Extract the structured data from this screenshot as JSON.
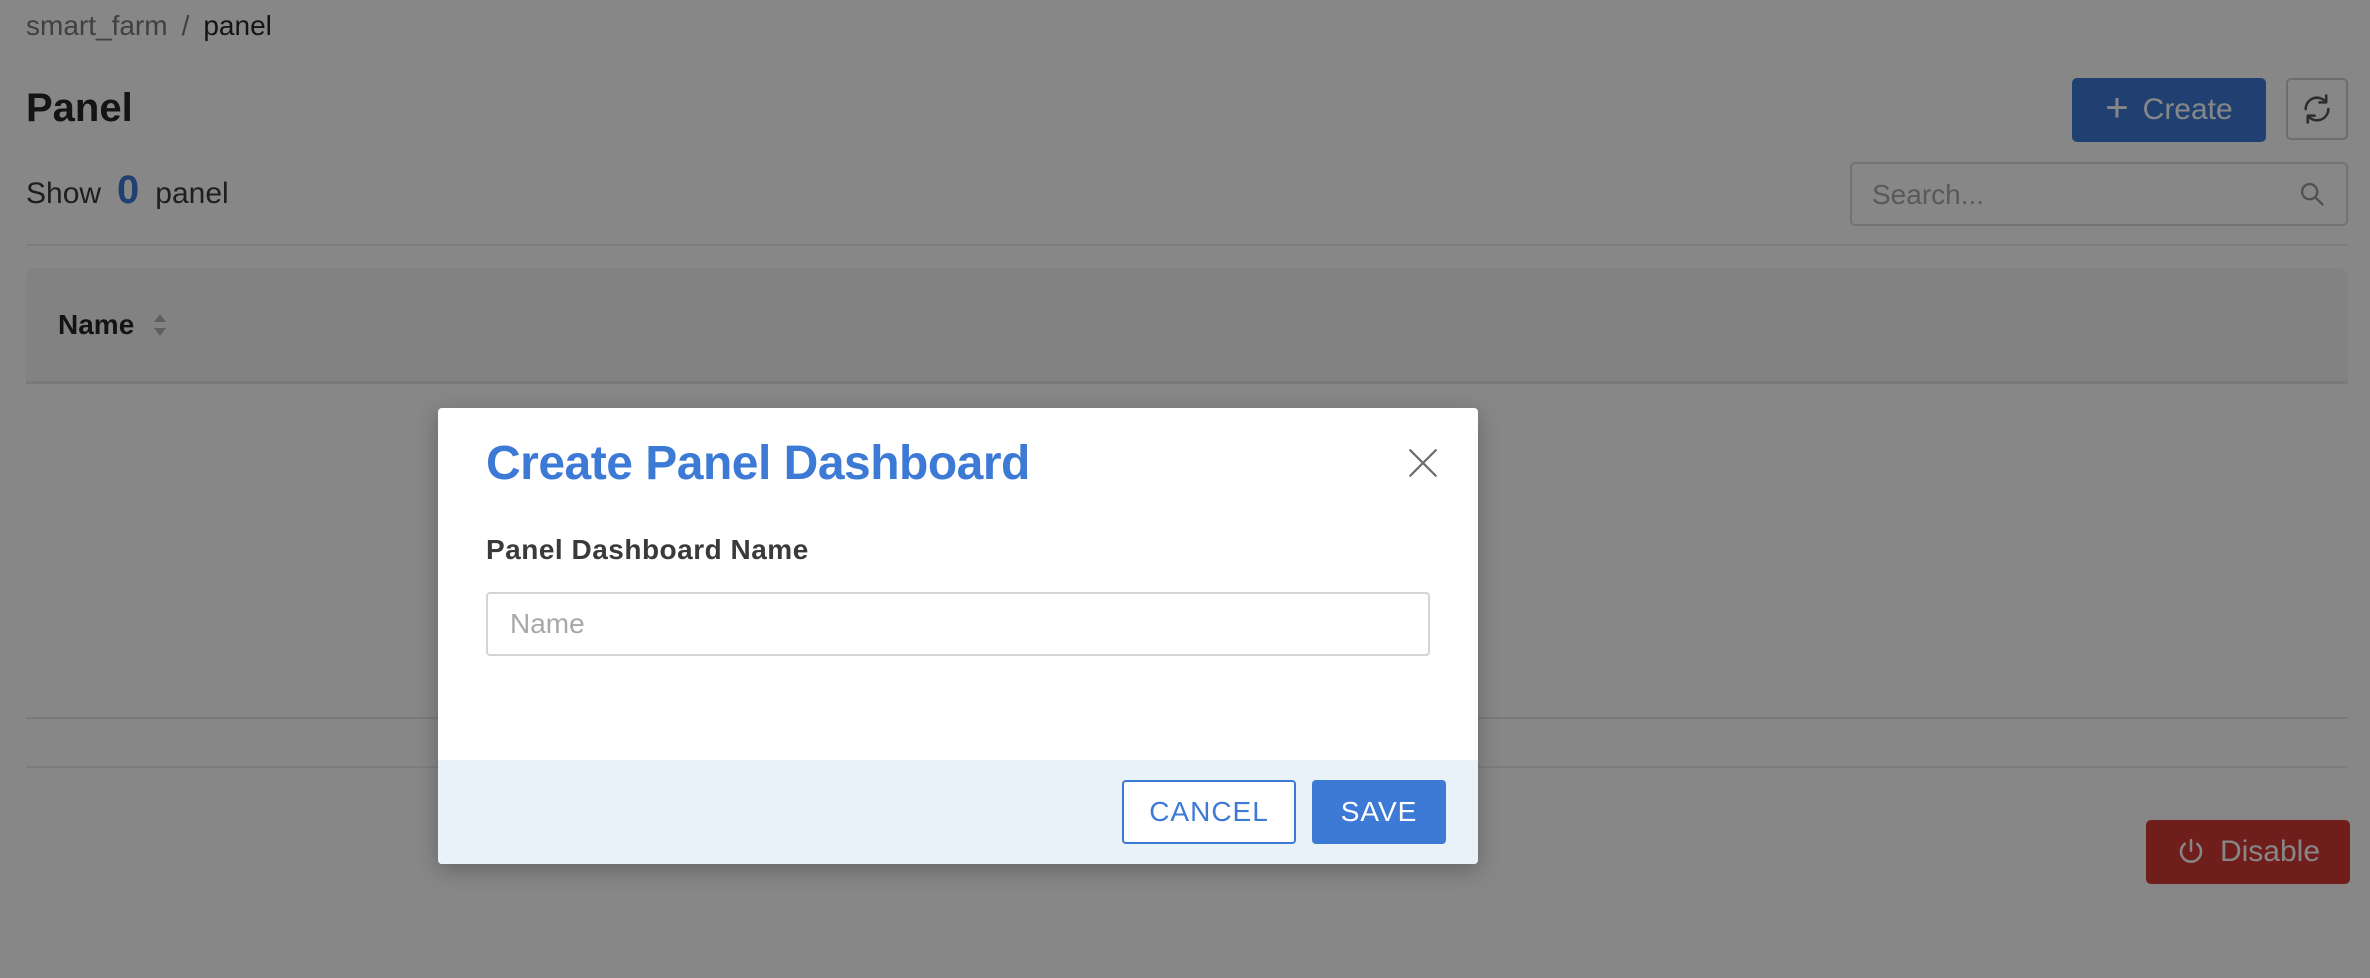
{
  "breadcrumb": {
    "parent": "smart_farm",
    "separator": "/",
    "current": "panel"
  },
  "page": {
    "title": "Panel"
  },
  "toolbar": {
    "create_label": "Create"
  },
  "summary": {
    "prefix": "Show",
    "count": "0",
    "suffix": "panel"
  },
  "search": {
    "placeholder": "Search..."
  },
  "table": {
    "columns": [
      {
        "label": "Name"
      }
    ],
    "rows": []
  },
  "footer": {
    "disable_label": "Disable"
  },
  "modal": {
    "title": "Create Panel Dashboard",
    "field_label": "Panel Dashboard Name",
    "name_placeholder": "Name",
    "name_value": "",
    "cancel_label": "CANCEL",
    "save_label": "SAVE"
  },
  "colors": {
    "accent": "#3d7ad6",
    "danger": "#d23a33",
    "modal_footer_bg": "#e9f1f9",
    "overlay": "rgba(0,0,0,0.47)"
  },
  "icons": [
    "plus-icon",
    "refresh-icon",
    "search-icon",
    "sort-icon",
    "power-icon",
    "close-icon"
  ]
}
